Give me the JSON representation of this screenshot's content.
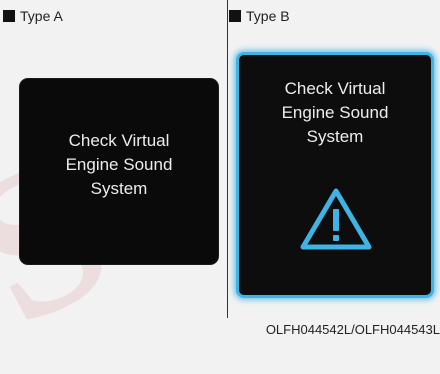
{
  "type_a": {
    "label": "Type A",
    "message": "Check Virtual\nEngine Sound\nSystem"
  },
  "type_b": {
    "label": "Type B",
    "message": "Check Virtual\nEngine Sound\nSystem",
    "icon": "warning-triangle-icon"
  },
  "figure_code": "OLFH044542L/OLFH044543L",
  "colors": {
    "accent_blue": "#3fb4e4",
    "panel_bg": "#0a0a0a",
    "text_light": "#ededed"
  }
}
